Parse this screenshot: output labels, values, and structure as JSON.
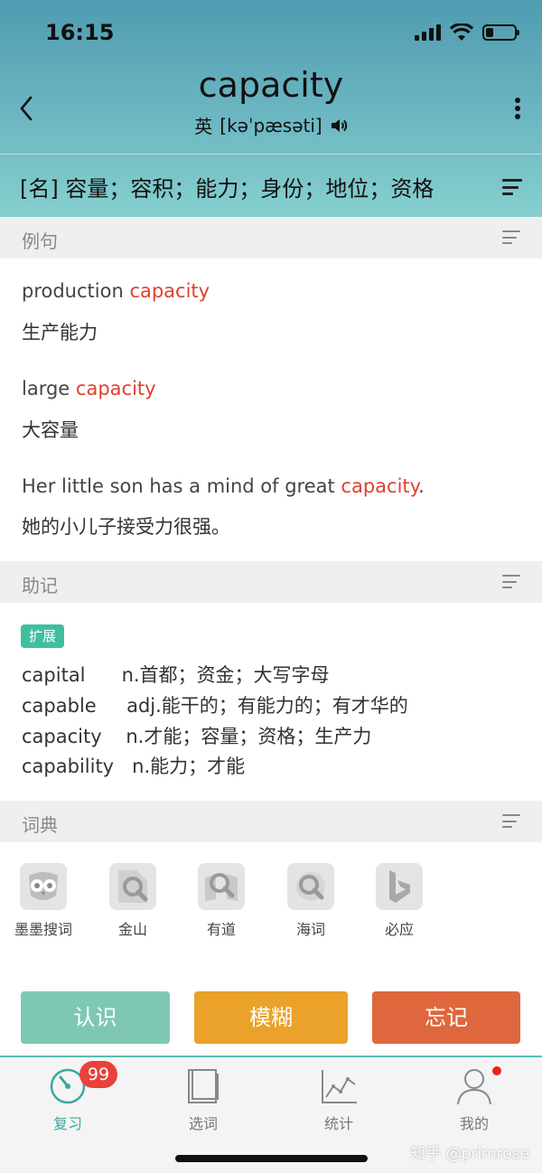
{
  "status": {
    "time": "16:15"
  },
  "header": {
    "word": "capacity",
    "pronunciation_label": "英",
    "phonetic": "[kəˈpæsəti]",
    "definition": "[名] 容量；容积；能力；身份；地位；资格"
  },
  "examples": {
    "title": "例句",
    "items": [
      {
        "en_before": "production ",
        "en_highlight": "capacity",
        "en_after": "",
        "zh": "生产能力"
      },
      {
        "en_before": "large ",
        "en_highlight": "capacity",
        "en_after": "",
        "zh": "大容量"
      },
      {
        "en_before": "Her little son has a mind of great ",
        "en_highlight": "capacity",
        "en_after": ".",
        "zh": "她的小儿子接受力很强。"
      }
    ]
  },
  "mnemonic": {
    "title": "助记",
    "badge": "扩展",
    "lines": [
      "capital      n.首都；资金；大写字母",
      "capable     adj.能干的；有能力的；有才华的",
      "capacity    n.才能；容量；资格；生产力",
      "capability   n.能力；才能"
    ]
  },
  "dictionary": {
    "title": "词典",
    "items": [
      {
        "label": "墨墨搜词",
        "icon": "owl-icon"
      },
      {
        "label": "金山",
        "icon": "kingsoft-icon"
      },
      {
        "label": "有道",
        "icon": "youdao-icon"
      },
      {
        "label": "海词",
        "icon": "dict-cn-icon"
      },
      {
        "label": "必应",
        "icon": "bing-icon"
      }
    ]
  },
  "actions": {
    "know": "认识",
    "fuzzy": "模糊",
    "forget": "忘记",
    "colors": {
      "know": "#7ec8b3",
      "fuzzy": "#eaa22b",
      "forget": "#df673d"
    }
  },
  "tabbar": {
    "review_count": "99",
    "tabs": [
      {
        "label": "复习",
        "icon": "review-dial-icon",
        "active": true
      },
      {
        "label": "选词",
        "icon": "wordbook-icon",
        "active": false
      },
      {
        "label": "统计",
        "icon": "chart-icon",
        "active": false
      },
      {
        "label": "我的",
        "icon": "profile-icon",
        "active": false
      }
    ]
  },
  "watermark": "知乎 @primrose"
}
